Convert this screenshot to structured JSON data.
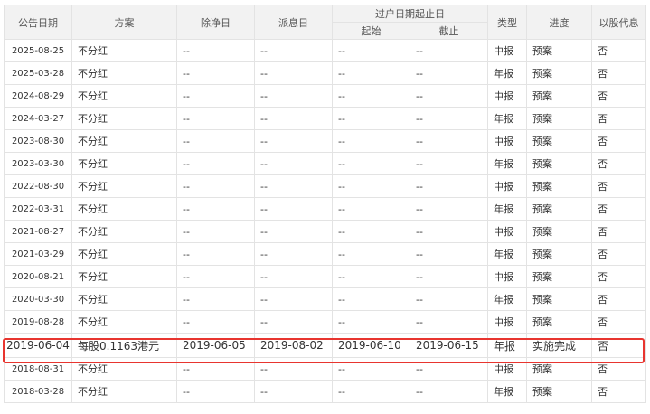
{
  "headers": {
    "date": "公告日期",
    "plan": "方案",
    "ex_date": "除净日",
    "pay_date": "派息日",
    "transfer": "过户日期起止日",
    "start": "起始",
    "end": "截止",
    "type": "类型",
    "progress": "进度",
    "scrip": "以股代息"
  },
  "rows": [
    {
      "date": "2025-08-25",
      "plan": "不分红",
      "ex": "--",
      "pay": "--",
      "start": "--",
      "end": "--",
      "type": "中报",
      "progress": "预案",
      "scrip": "否"
    },
    {
      "date": "2025-03-28",
      "plan": "不分红",
      "ex": "--",
      "pay": "--",
      "start": "--",
      "end": "--",
      "type": "年报",
      "progress": "预案",
      "scrip": "否"
    },
    {
      "date": "2024-08-29",
      "plan": "不分红",
      "ex": "--",
      "pay": "--",
      "start": "--",
      "end": "--",
      "type": "中报",
      "progress": "预案",
      "scrip": "否"
    },
    {
      "date": "2024-03-27",
      "plan": "不分红",
      "ex": "--",
      "pay": "--",
      "start": "--",
      "end": "--",
      "type": "年报",
      "progress": "预案",
      "scrip": "否"
    },
    {
      "date": "2023-08-30",
      "plan": "不分红",
      "ex": "--",
      "pay": "--",
      "start": "--",
      "end": "--",
      "type": "中报",
      "progress": "预案",
      "scrip": "否"
    },
    {
      "date": "2023-03-30",
      "plan": "不分红",
      "ex": "--",
      "pay": "--",
      "start": "--",
      "end": "--",
      "type": "年报",
      "progress": "预案",
      "scrip": "否"
    },
    {
      "date": "2022-08-30",
      "plan": "不分红",
      "ex": "--",
      "pay": "--",
      "start": "--",
      "end": "--",
      "type": "中报",
      "progress": "预案",
      "scrip": "否"
    },
    {
      "date": "2022-03-31",
      "plan": "不分红",
      "ex": "--",
      "pay": "--",
      "start": "--",
      "end": "--",
      "type": "年报",
      "progress": "预案",
      "scrip": "否"
    },
    {
      "date": "2021-08-27",
      "plan": "不分红",
      "ex": "--",
      "pay": "--",
      "start": "--",
      "end": "--",
      "type": "中报",
      "progress": "预案",
      "scrip": "否"
    },
    {
      "date": "2021-03-29",
      "plan": "不分红",
      "ex": "--",
      "pay": "--",
      "start": "--",
      "end": "--",
      "type": "年报",
      "progress": "预案",
      "scrip": "否"
    },
    {
      "date": "2020-08-21",
      "plan": "不分红",
      "ex": "--",
      "pay": "--",
      "start": "--",
      "end": "--",
      "type": "中报",
      "progress": "预案",
      "scrip": "否"
    },
    {
      "date": "2020-03-30",
      "plan": "不分红",
      "ex": "--",
      "pay": "--",
      "start": "--",
      "end": "--",
      "type": "年报",
      "progress": "预案",
      "scrip": "否"
    },
    {
      "date": "2019-08-28",
      "plan": "不分红",
      "ex": "--",
      "pay": "--",
      "start": "--",
      "end": "--",
      "type": "中报",
      "progress": "预案",
      "scrip": "否"
    },
    {
      "date": "2019-06-04",
      "plan": "每股0.1163港元",
      "ex": "2019-06-05",
      "pay": "2019-08-02",
      "start": "2019-06-10",
      "end": "2019-06-15",
      "type": "年报",
      "progress": "实施完成",
      "scrip": "否",
      "highlighted": true
    },
    {
      "date": "2018-08-31",
      "plan": "不分红",
      "ex": "--",
      "pay": "--",
      "start": "--",
      "end": "--",
      "type": "中报",
      "progress": "预案",
      "scrip": "否"
    },
    {
      "date": "2018-03-28",
      "plan": "不分红",
      "ex": "--",
      "pay": "--",
      "start": "--",
      "end": "--",
      "type": "年报",
      "progress": "预案",
      "scrip": "否"
    }
  ],
  "colors": {
    "header_bg": "#f2f2f2",
    "border": "#e3e3e3",
    "highlight": "#e8352f"
  }
}
